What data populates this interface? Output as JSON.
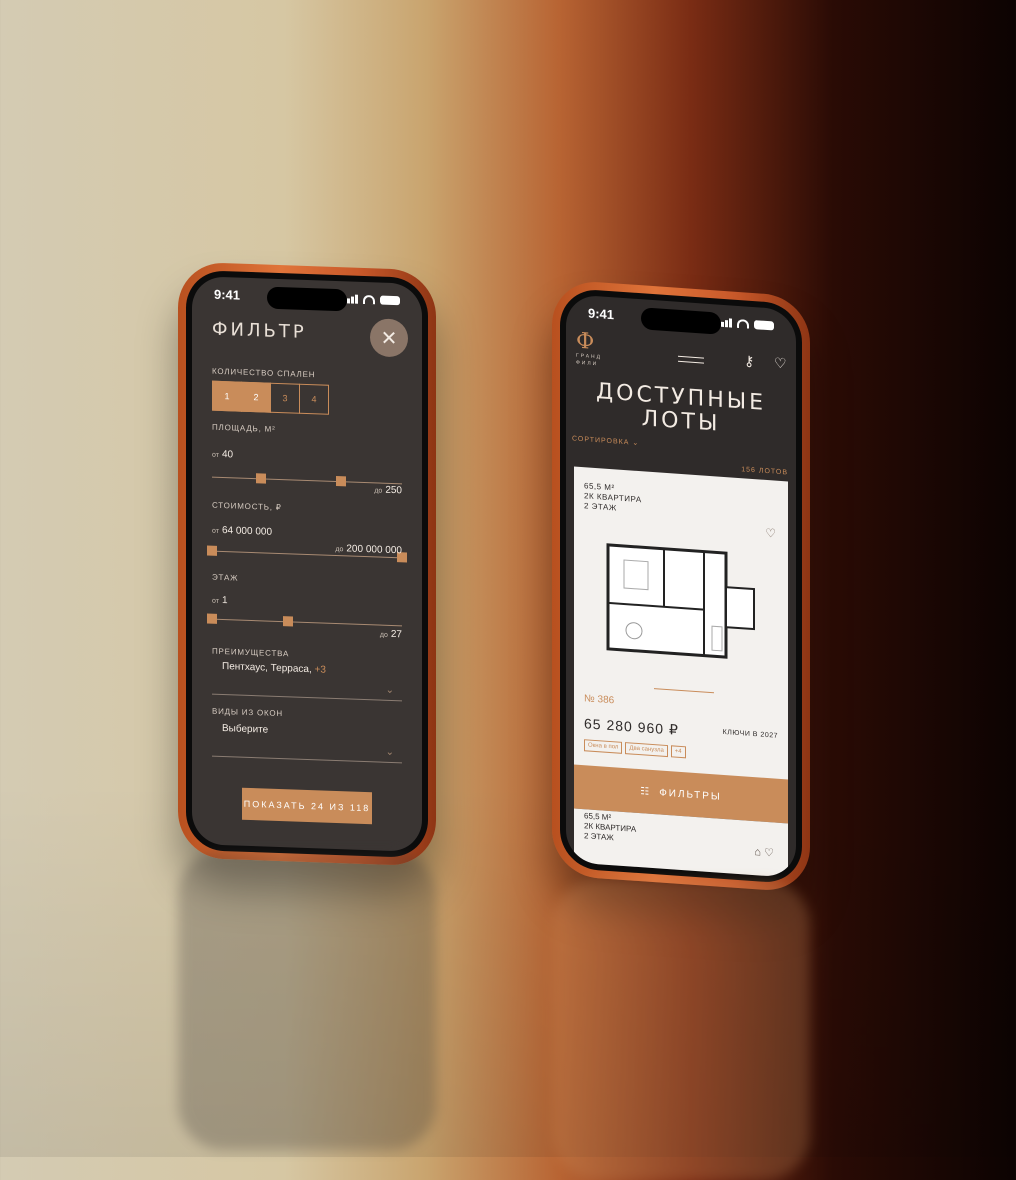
{
  "colors": {
    "accent": "#c98c5a",
    "dark_bg": "#3a3533",
    "card_bg": "#f3f1ee",
    "phone_frame": "#d0652f"
  },
  "filter_phone": {
    "status_time": "9:41",
    "title": "ФИЛЬТР",
    "close_icon": "close-icon",
    "bedrooms": {
      "label": "КОЛИЧЕСТВО СПАЛЕН",
      "options": [
        "1",
        "2",
        "3",
        "4"
      ],
      "selected": [
        "1",
        "2"
      ]
    },
    "area": {
      "label": "ПЛОЩАДЬ, М²",
      "from_prefix": "от",
      "from": "40",
      "to_prefix": "до",
      "to": "250",
      "range_fraction": [
        0.26,
        0.68
      ]
    },
    "price": {
      "label": "СТОИМОСТЬ, ₽",
      "from_prefix": "от",
      "from": "64 000 000",
      "to_prefix": "до",
      "to": "200 000 000",
      "range_fraction": [
        0,
        1
      ]
    },
    "floor": {
      "label": "ЭТАЖ",
      "from_prefix": "от",
      "from": "1",
      "to_prefix": "до",
      "to": "27",
      "range_fraction": [
        0,
        0.4
      ]
    },
    "advantages": {
      "label": "ПРЕИМУЩЕСТВА",
      "value": "Пентхаус, Терраса,",
      "extra": "+3"
    },
    "views": {
      "label": "ВИДЫ ИЗ ОКОН",
      "value": "Выберите"
    },
    "show_button": "ПОКАЗАТЬ 24 ИЗ 118"
  },
  "listing_phone": {
    "status_time": "9:41",
    "logo_mark": "Ф",
    "logo_text_1": "ГРАНД",
    "logo_text_2": "ФИЛИ",
    "headline_1": "ДОСТУПНЫЕ",
    "headline_2": "ЛОТЫ",
    "sort_label": "СОРТИРОВКА",
    "lots_count": "156 ЛОТОВ",
    "card": {
      "area": "65,5 М²",
      "type": "2К КВАРТИРА",
      "floor": "2 ЭТАЖ",
      "number": "№ 386",
      "price": "65 280 960 ₽",
      "keys": "КЛЮЧИ В 2027",
      "tags": [
        "Окна в пол",
        "Два санузла",
        "+4"
      ]
    },
    "filters_button": "ФИЛЬТРЫ",
    "card2": {
      "area": "65,5 М²",
      "type": "2К КВАРТИРА",
      "floor": "2 ЭТАЖ"
    }
  }
}
